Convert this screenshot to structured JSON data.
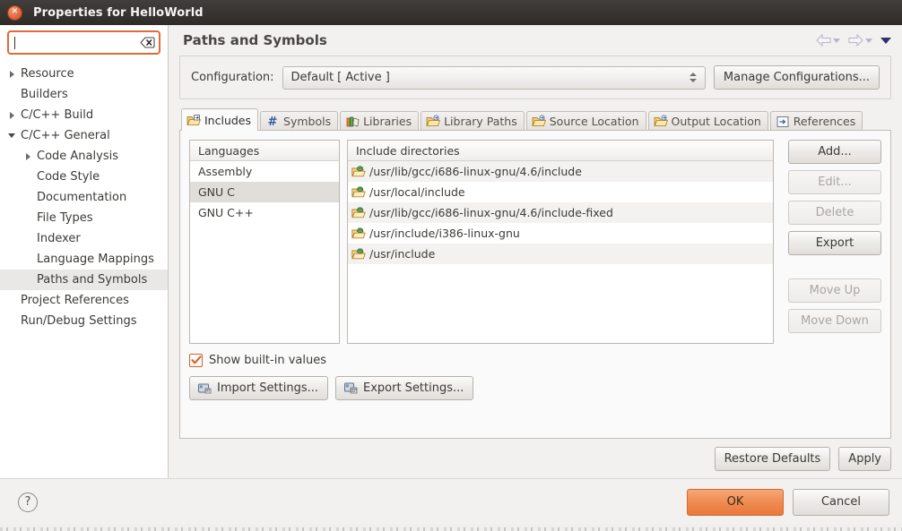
{
  "window": {
    "title": "Properties for HelloWorld",
    "close_icon": "close-icon"
  },
  "sidebar": {
    "search": {
      "value": "",
      "placeholder": "",
      "clear_icon": "clear-icon"
    },
    "items": [
      {
        "label": "Resource",
        "indent": 0,
        "twisty": "collapsed",
        "selected": false
      },
      {
        "label": "Builders",
        "indent": 0,
        "twisty": "none",
        "selected": false
      },
      {
        "label": "C/C++ Build",
        "indent": 0,
        "twisty": "collapsed",
        "selected": false
      },
      {
        "label": "C/C++ General",
        "indent": 0,
        "twisty": "expanded",
        "selected": false
      },
      {
        "label": "Code Analysis",
        "indent": 1,
        "twisty": "collapsed",
        "selected": false
      },
      {
        "label": "Code Style",
        "indent": 1,
        "twisty": "none",
        "selected": false
      },
      {
        "label": "Documentation",
        "indent": 1,
        "twisty": "none",
        "selected": false
      },
      {
        "label": "File Types",
        "indent": 1,
        "twisty": "none",
        "selected": false
      },
      {
        "label": "Indexer",
        "indent": 1,
        "twisty": "none",
        "selected": false
      },
      {
        "label": "Language Mappings",
        "indent": 1,
        "twisty": "none",
        "selected": false
      },
      {
        "label": "Paths and Symbols",
        "indent": 1,
        "twisty": "none",
        "selected": true
      },
      {
        "label": "Project References",
        "indent": 0,
        "twisty": "none",
        "selected": false
      },
      {
        "label": "Run/Debug Settings",
        "indent": 0,
        "twisty": "none",
        "selected": false
      }
    ]
  },
  "page": {
    "title": "Paths and Symbols",
    "nav": {
      "back_icon": "back-arrow-icon",
      "back_menu_icon": "chevron-down-icon",
      "forward_icon": "forward-arrow-icon",
      "forward_menu_icon": "chevron-down-icon",
      "menu_icon": "chevron-down-icon"
    }
  },
  "configuration": {
    "label": "Configuration:",
    "value": "Default  [ Active ]",
    "spinner_icon": "spinner-updown-icon",
    "manage_button": "Manage Configurations..."
  },
  "tabs": [
    {
      "label": "Includes",
      "icon": "includes-folder-icon",
      "active": true
    },
    {
      "label": "Symbols",
      "icon": "hash-icon",
      "active": false
    },
    {
      "label": "Libraries",
      "icon": "books-icon",
      "active": false
    },
    {
      "label": "Library Paths",
      "icon": "library-folder-icon",
      "active": false
    },
    {
      "label": "Source Location",
      "icon": "source-folder-icon",
      "active": false
    },
    {
      "label": "Output Location",
      "icon": "output-folder-icon",
      "active": false
    },
    {
      "label": "References",
      "icon": "references-icon",
      "active": false
    }
  ],
  "languages": {
    "header": "Languages",
    "rows": [
      {
        "label": "Assembly",
        "selected": false
      },
      {
        "label": "GNU C",
        "selected": true
      },
      {
        "label": "GNU C++",
        "selected": false
      }
    ]
  },
  "includes": {
    "header": "Include directories",
    "rows": [
      {
        "path": "/usr/lib/gcc/i686-linux-gnu/4.6/include",
        "icon": "builtin-folder-icon",
        "builtin": true
      },
      {
        "path": "/usr/local/include",
        "icon": "builtin-folder-icon",
        "builtin": true
      },
      {
        "path": "/usr/lib/gcc/i686-linux-gnu/4.6/include-fixed",
        "icon": "builtin-folder-icon",
        "builtin": true
      },
      {
        "path": "/usr/include/i386-linux-gnu",
        "icon": "builtin-folder-icon",
        "builtin": true
      },
      {
        "path": "/usr/include",
        "icon": "builtin-folder-icon",
        "builtin": true
      }
    ]
  },
  "side_buttons": [
    {
      "label": "Add...",
      "enabled": true
    },
    {
      "label": "Edit...",
      "enabled": false
    },
    {
      "label": "Delete",
      "enabled": false
    },
    {
      "label": "Export",
      "enabled": true
    }
  ],
  "move_buttons": [
    {
      "label": "Move Up",
      "enabled": false
    },
    {
      "label": "Move Down",
      "enabled": false
    }
  ],
  "show_builtin": {
    "label": "Show built-in values",
    "checked": true,
    "check_icon": "checkmark-icon"
  },
  "settings_buttons": [
    {
      "label": "Import Settings...",
      "icon": "import-icon"
    },
    {
      "label": "Export Settings...",
      "icon": "export-icon"
    }
  ],
  "dialog_buttons": {
    "restore_defaults": "Restore Defaults",
    "apply": "Apply",
    "ok": "OK",
    "cancel": "Cancel",
    "help_icon": "help-icon",
    "help_glyph": "?"
  },
  "colors": {
    "accent_orange": "#e9793a",
    "focus_orange": "#e06a38",
    "titlebar_dark": "#2e2b28",
    "panel_bg": "#f2f1f0",
    "selection_grey": "#e0dedb"
  }
}
